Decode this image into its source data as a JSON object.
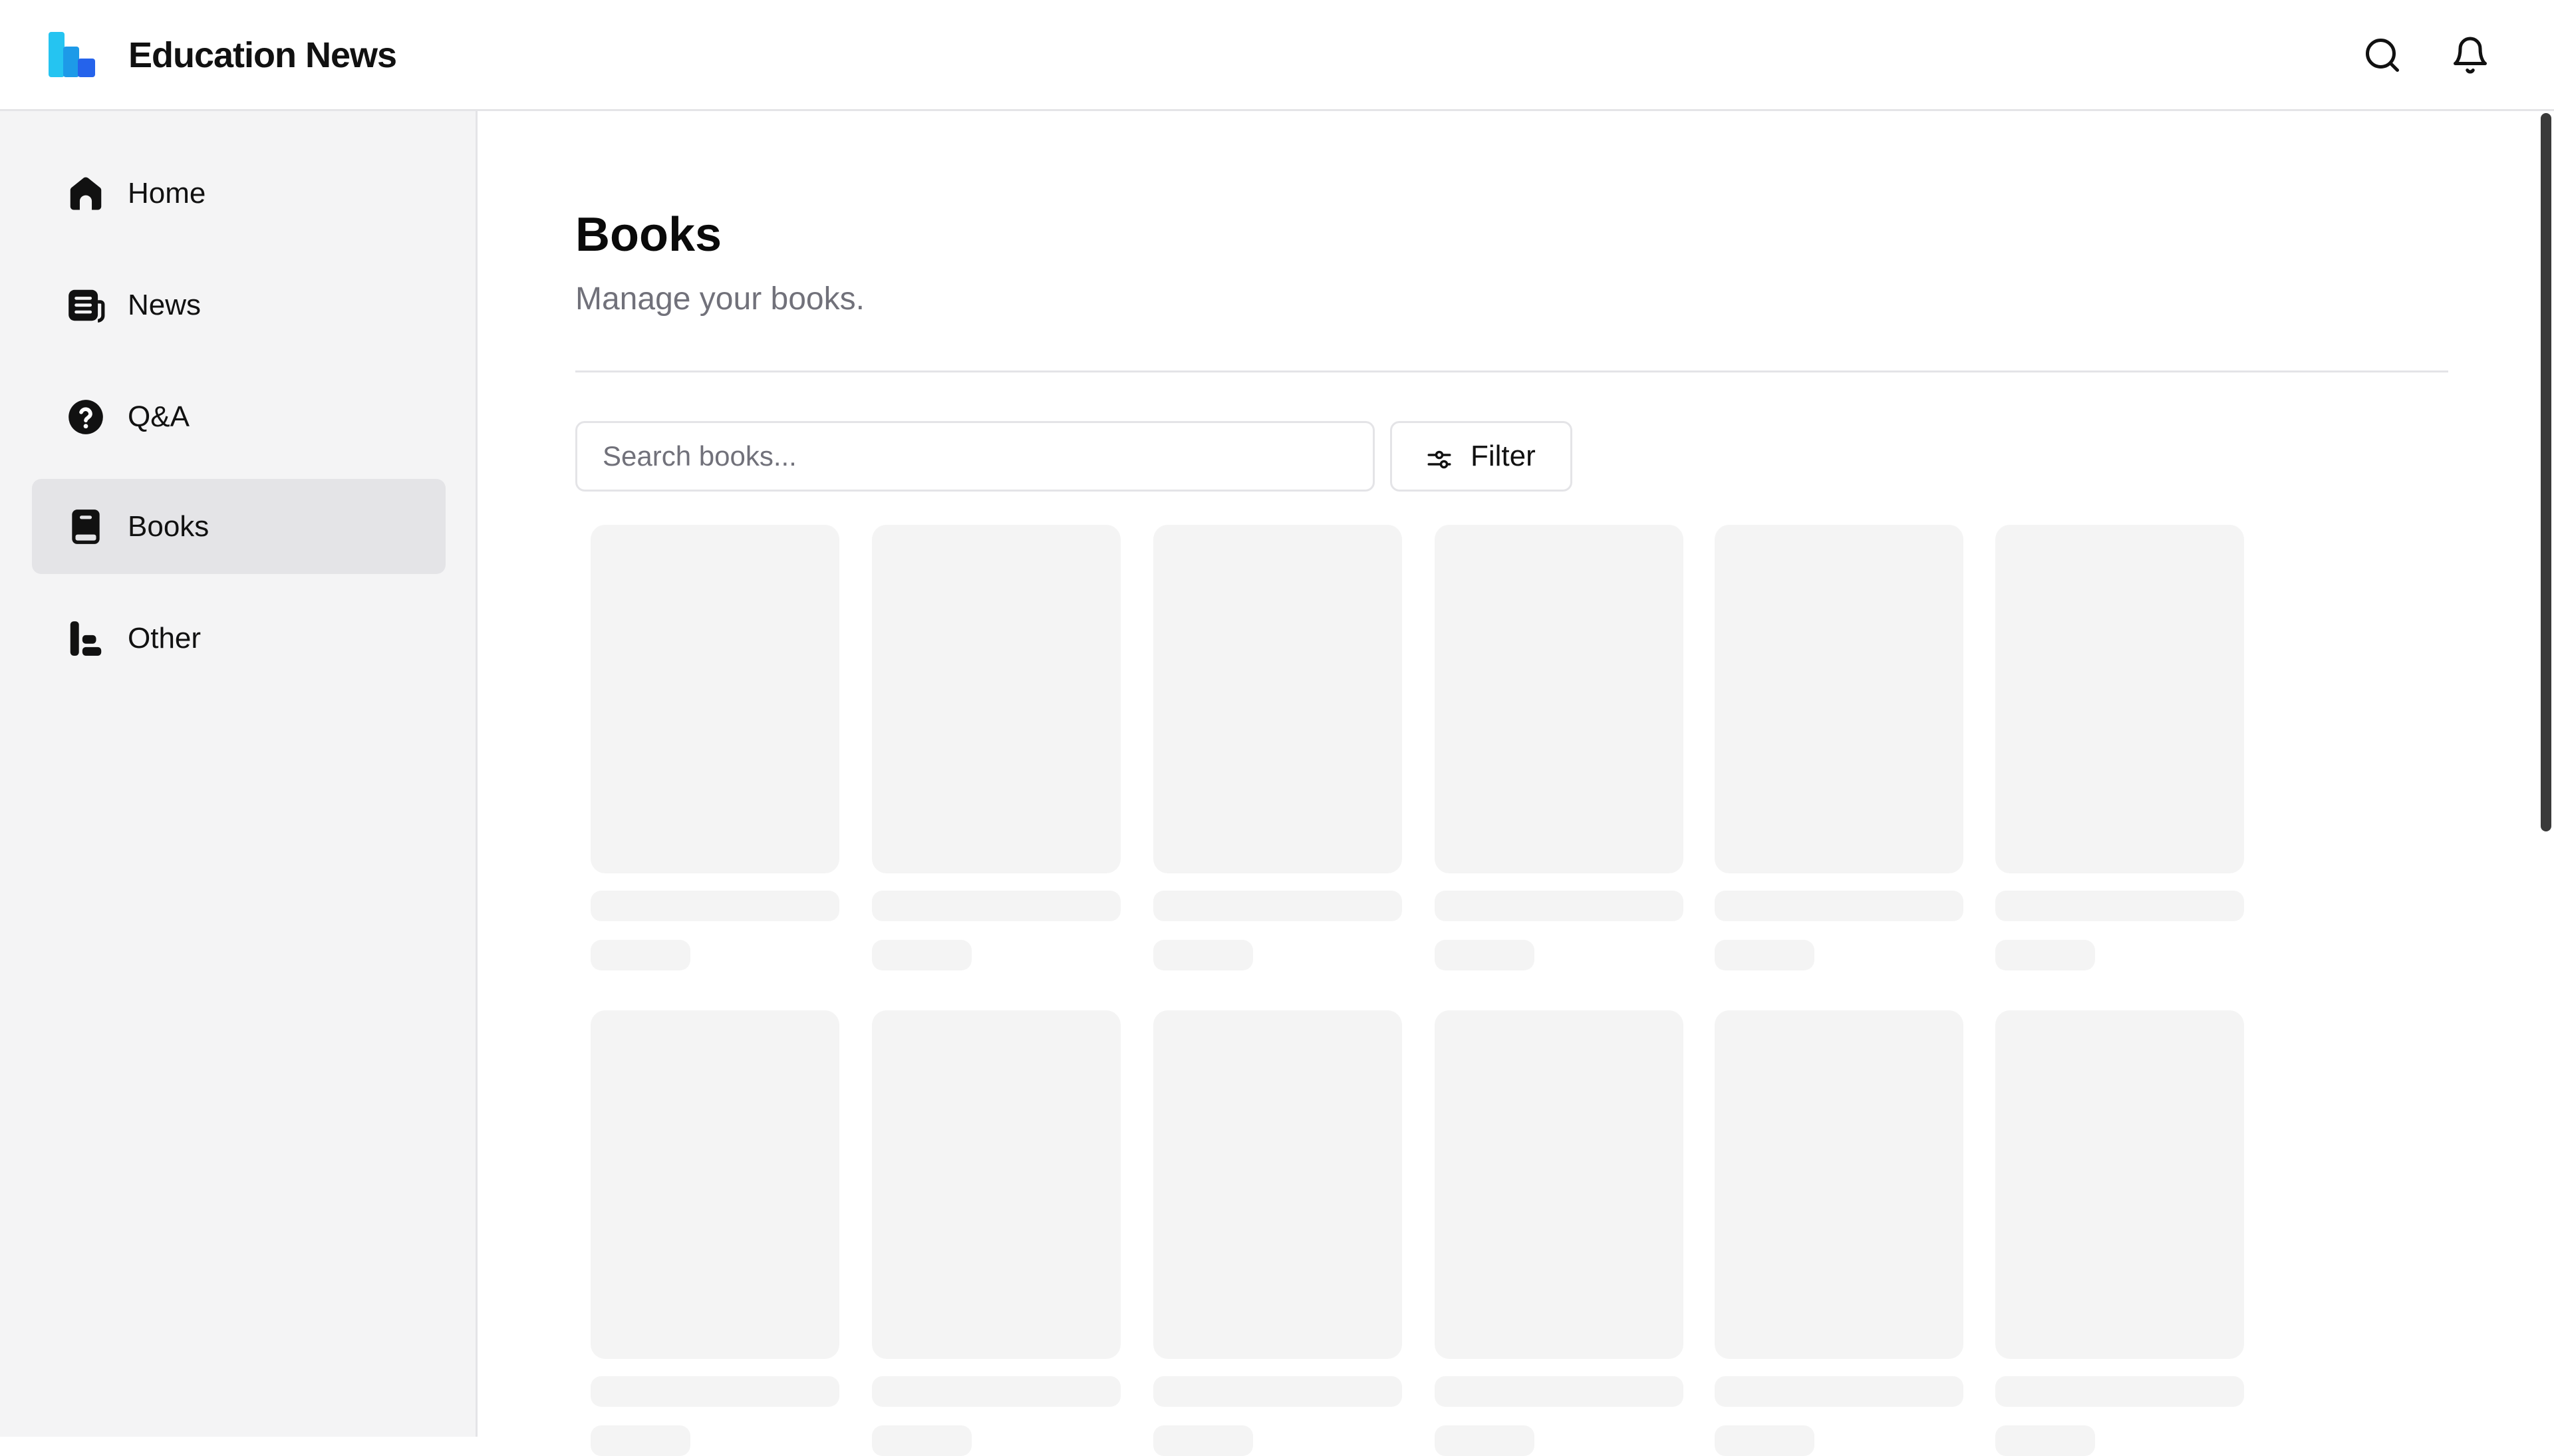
{
  "app": {
    "title": "Education News",
    "logo_colors": [
      "#25c4f1",
      "#1d9ae8",
      "#2563eb"
    ]
  },
  "header": {
    "icons": [
      "search-icon",
      "bell-icon"
    ]
  },
  "sidebar": {
    "items": [
      {
        "label": "Home",
        "icon": "home-icon",
        "active": false
      },
      {
        "label": "News",
        "icon": "newspaper-icon",
        "active": false
      },
      {
        "label": "Q&A",
        "icon": "question-circle-icon",
        "active": false
      },
      {
        "label": "Books",
        "icon": "book-icon",
        "active": true
      },
      {
        "label": "Other",
        "icon": "other-icon",
        "active": false
      }
    ]
  },
  "main": {
    "title": "Books",
    "subtitle": "Manage your books.",
    "search": {
      "placeholder": "Search books...",
      "value": ""
    },
    "filter_label": "Filter",
    "filter_icon": "sliders-icon"
  },
  "colors": {
    "accent_bg": "#e4e4e7",
    "sidebar_bg": "#f4f4f5",
    "skeleton": "#f4f4f4",
    "muted_text": "#71717a"
  }
}
